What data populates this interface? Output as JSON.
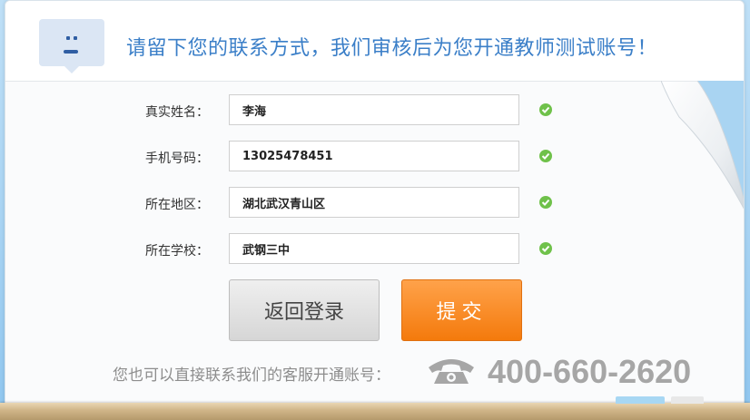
{
  "header": {
    "title": "请留下您的联系方式，我们审核后为您开通教师测试账号！"
  },
  "form": {
    "fields": [
      {
        "label": "真实姓名：",
        "value": "李海"
      },
      {
        "label": "手机号码：",
        "value": "13025478451"
      },
      {
        "label": "所在地区：",
        "value": "湖北武汉青山区"
      },
      {
        "label": "所在学校：",
        "value": "武钢三中"
      }
    ]
  },
  "buttons": {
    "back_label": "返回登录",
    "submit_label": "提交"
  },
  "contact": {
    "text": "您也可以直接联系我们的客服开通账号：",
    "phone": "400-660-2620"
  },
  "colors": {
    "title": "#3b7fc8",
    "submit": "#f47a0c",
    "check": "#6fc14a",
    "phone": "#a6a6a6"
  },
  "icons": [
    "face-icon",
    "check-icon",
    "phone-icon"
  ]
}
